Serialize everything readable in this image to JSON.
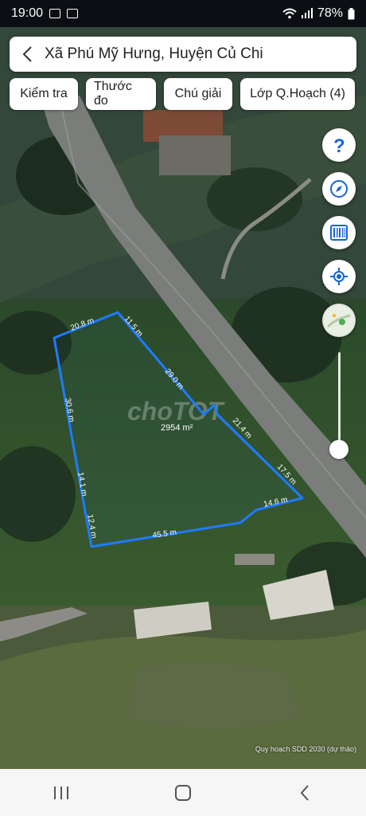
{
  "status": {
    "time": "19:00",
    "battery": "78%"
  },
  "search": {
    "title": "Xã Phú Mỹ Hưng, Huyện Củ Chi"
  },
  "chips": [
    "Kiểm tra",
    "Thước đo",
    "Chú giải",
    "Lớp Q.Hoạch (4)"
  ],
  "map": {
    "watermark": "choTOT",
    "area_label": "2954 m²",
    "edges": [
      "20.8 m",
      "11.5 m",
      "29.0 m",
      "21.4 m",
      "17.5 m",
      "14.6 m",
      "45.5 m",
      "12.4 m",
      "14.1 m",
      "30.6 m"
    ],
    "footer": "Quy hoạch SDD 2030 (dự thảo)"
  },
  "fabs": [
    "help-icon",
    "compass-icon",
    "barcode-icon",
    "locate-icon",
    "map-thumbnail-icon"
  ],
  "colors": {
    "parcel_outline": "#1e7bff",
    "fab_icon": "#1565d8"
  }
}
